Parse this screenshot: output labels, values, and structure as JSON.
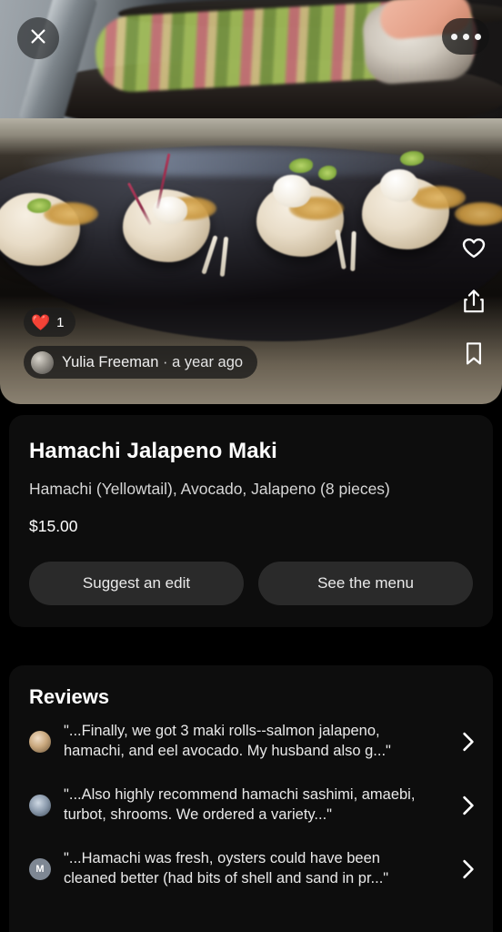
{
  "photo": {
    "close_label": "Close",
    "more_label": "More options",
    "like_count": "1",
    "heart_emoji": "❤️",
    "author_name": "Yulia Freeman",
    "separator": "·",
    "time_ago": "a year ago",
    "actions": {
      "like": "heart-icon",
      "share": "share-icon",
      "save": "bookmark-icon"
    }
  },
  "details": {
    "title": "Hamachi Jalapeno Maki",
    "description": "Hamachi (Yellowtail), Avocado, Jalapeno (8 pieces)",
    "price": "$15.00",
    "suggest_edit_label": "Suggest an edit",
    "see_menu_label": "See the menu"
  },
  "reviews": {
    "heading": "Reviews",
    "items": [
      {
        "avatar_kind": "photo",
        "avatar_initial": "",
        "snippet": "\"...Finally, we got 3 maki rolls--salmon jalapeno, hamachi, and eel avocado. My husband also g...\""
      },
      {
        "avatar_kind": "photo",
        "avatar_initial": "",
        "snippet": "\"...Also highly recommend hamachi sashimi, amaebi, turbot, shrooms. We ordered a variety...\""
      },
      {
        "avatar_kind": "initial",
        "avatar_initial": "M",
        "snippet": "\"...Hamachi was fresh, oysters could have been cleaned better (had bits of shell and sand in pr...\""
      }
    ]
  },
  "colors": {
    "background": "#000000",
    "card": "#0d0d0d",
    "button": "#2a2a2a",
    "text_primary": "#ffffff",
    "text_secondary": "#d6d6d6",
    "heart_red": "#e8333a"
  }
}
